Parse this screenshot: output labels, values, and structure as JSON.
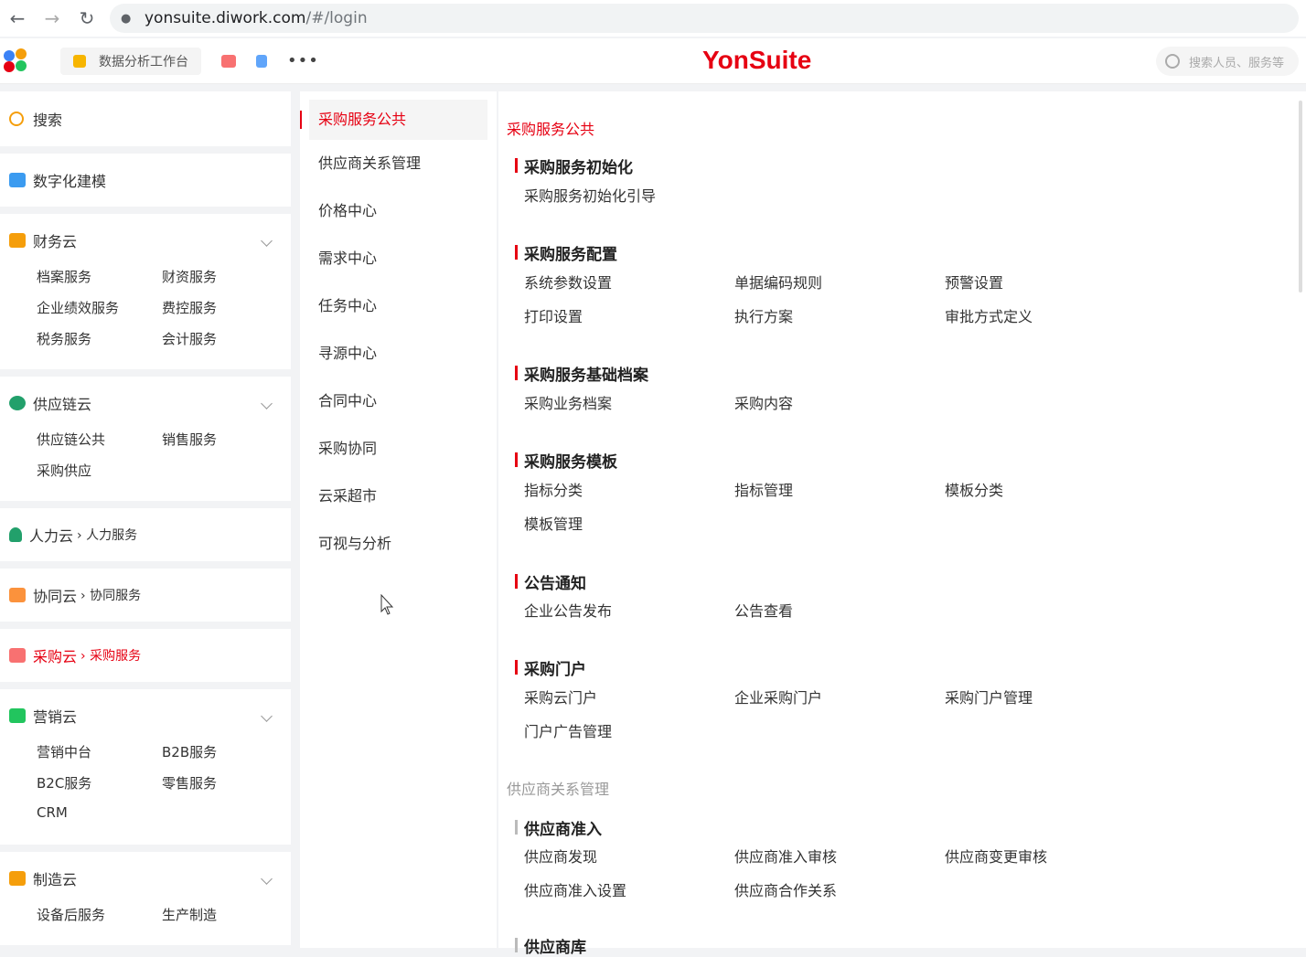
{
  "browser": {
    "url_host": "yonsuite.diwork.com",
    "url_path": "/#/login"
  },
  "appbar": {
    "tab_label": "数据分析工作台",
    "brand_yon": "Yon",
    "brand_suite": "Suite",
    "search_placeholder": "搜索人员、服务等"
  },
  "sidebar": {
    "search": "搜索",
    "digital": "数字化建模",
    "finance": {
      "title": "财务云",
      "items": [
        "档案服务",
        "财资服务",
        "企业绩效服务",
        "费控服务",
        "税务服务",
        "会计服务"
      ]
    },
    "supply": {
      "title": "供应链云",
      "items": [
        "供应链公共",
        "销售服务",
        "采购供应"
      ]
    },
    "hr": {
      "title": "人力云",
      "sub": "人力服务"
    },
    "collab": {
      "title": "协同云",
      "sub": "协同服务"
    },
    "purchase": {
      "title": "采购云",
      "sub": "采购服务"
    },
    "marketing": {
      "title": "营销云",
      "items": [
        "营销中台",
        "B2B服务",
        "B2C服务",
        "零售服务",
        "CRM"
      ]
    },
    "manufacturing": {
      "title": "制造云",
      "items": [
        "设备后服务",
        "生产制造"
      ]
    }
  },
  "midmenu": [
    "采购服务公共",
    "供应商关系管理",
    "价格中心",
    "需求中心",
    "任务中心",
    "寻源中心",
    "合同中心",
    "采购协同",
    "云采超市",
    "可视与分析"
  ],
  "content": {
    "section1": "采购服务公共",
    "g1": {
      "title": "采购服务初始化",
      "links": [
        "采购服务初始化引导"
      ]
    },
    "g2": {
      "title": "采购服务配置",
      "links": [
        "系统参数设置",
        "单据编码规则",
        "预警设置",
        "打印设置",
        "执行方案",
        "审批方式定义"
      ]
    },
    "g3": {
      "title": "采购服务基础档案",
      "links": [
        "采购业务档案",
        "采购内容"
      ]
    },
    "g4": {
      "title": "采购服务模板",
      "links": [
        "指标分类",
        "指标管理",
        "模板分类",
        "模板管理"
      ]
    },
    "g5": {
      "title": "公告通知",
      "links": [
        "企业公告发布",
        "公告查看"
      ]
    },
    "g6": {
      "title": "采购门户",
      "links": [
        "采购云门户",
        "企业采购门户",
        "采购门户管理",
        "门户广告管理"
      ]
    },
    "section2": "供应商关系管理",
    "g7": {
      "title": "供应商准入",
      "links": [
        "供应商发现",
        "供应商准入审核",
        "供应商变更审核",
        "供应商准入设置",
        "供应商合作关系"
      ]
    },
    "g8": {
      "title": "供应商库"
    }
  }
}
